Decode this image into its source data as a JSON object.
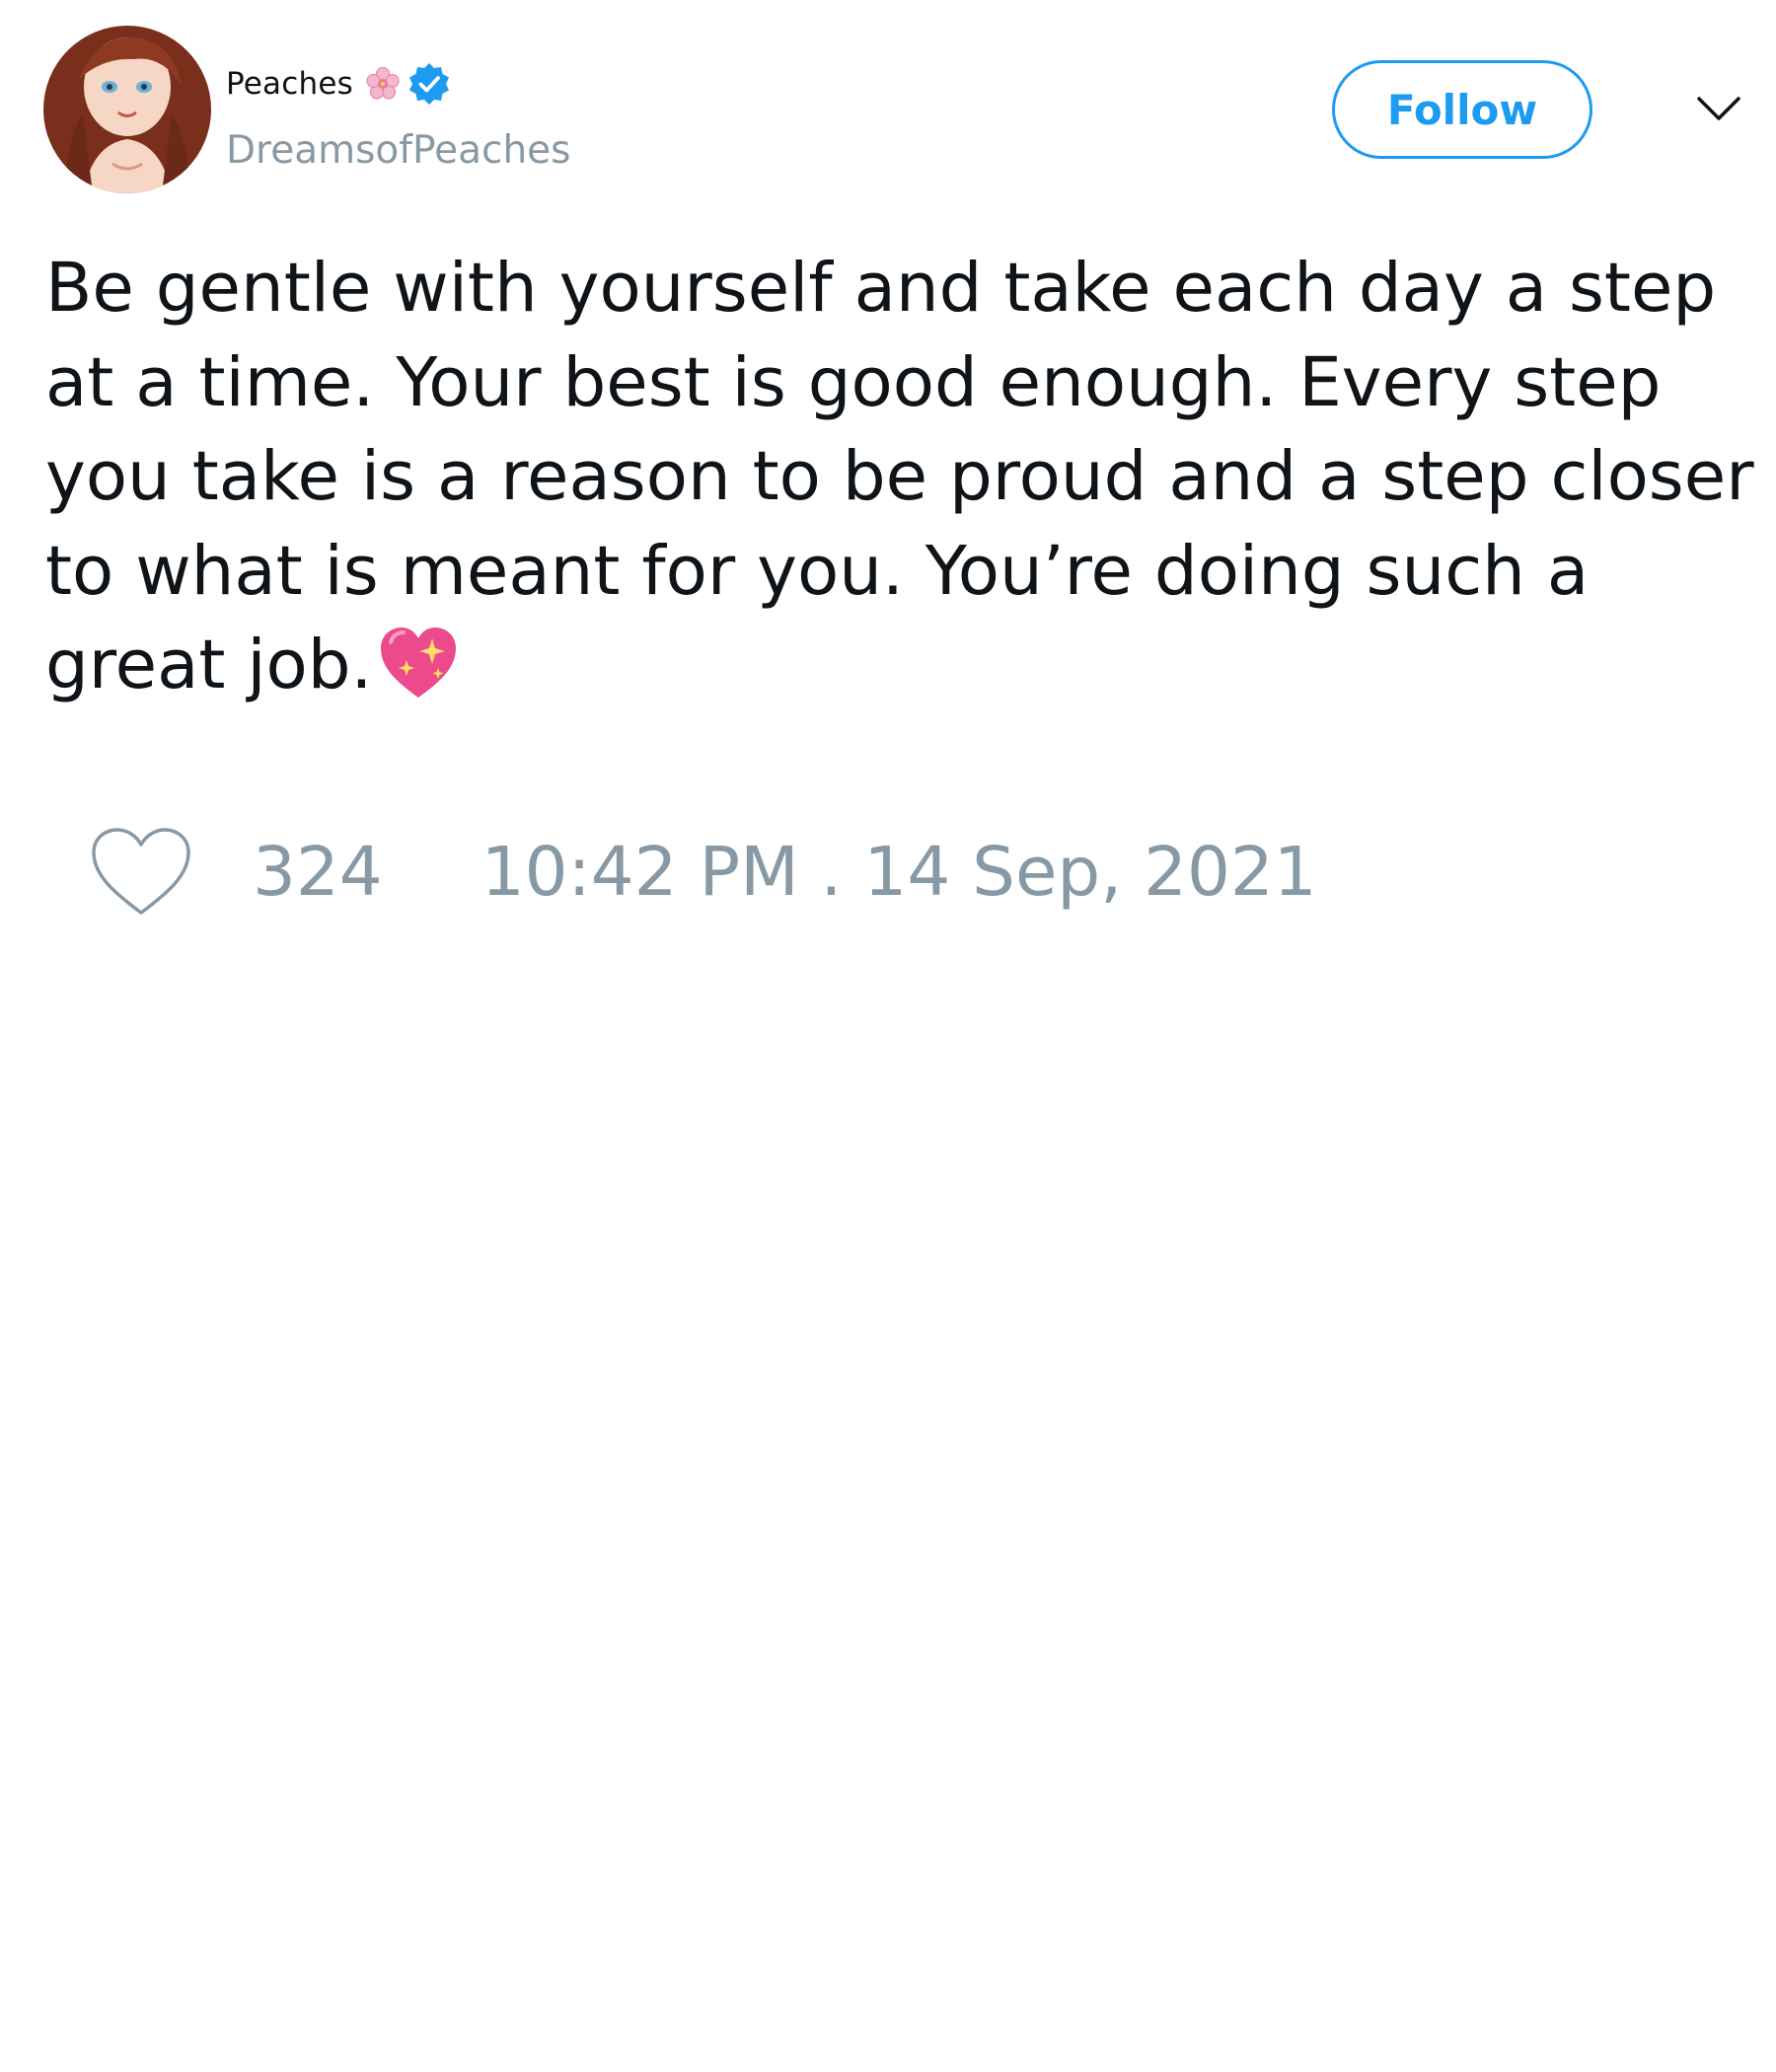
{
  "author": {
    "display_name": "Peaches",
    "handle": "DreamsofPeaches",
    "name_emoji": "flower-icon",
    "verified_icon": "verified-badge-icon",
    "accent_color": "#1d9bf0"
  },
  "actions": {
    "follow_label": "Follow",
    "menu_icon": "chevron-down-icon"
  },
  "tweet": {
    "text": "Be gentle with yourself and take each day a step\nat a time. Your best is good enough. Every step\nyou take is a reason to be proud and a step closer\nto what is meant for you. You’re doing such a\ngreat job.",
    "trailing_emoji": "sparkling-heart-icon"
  },
  "footer": {
    "like_icon": "heart-icon",
    "like_count": "324",
    "timestamp": "10:42 PM . 14 Sep, 2021",
    "meta_color": "#8899a6"
  }
}
